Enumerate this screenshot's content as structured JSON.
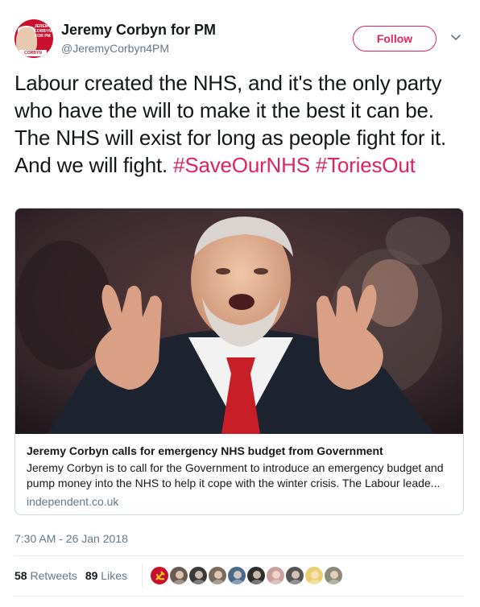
{
  "author": {
    "display_name": "Jeremy Corbyn for PM",
    "handle": "@JeremyCorbyn4PM",
    "avatar_text": "JEREMY CORBYN FOR PM",
    "avatar_strip": "CORBYN"
  },
  "follow_button": "Follow",
  "tweet": {
    "text": "Labour created the NHS, and it's the only party who have the will to make it the best it can be. The NHS will exist for long as people fight for it. And we will fight. ",
    "hashtags": [
      "#SaveOurNHS",
      "#ToriesOut"
    ]
  },
  "card": {
    "title": "Jeremy Corbyn calls for emergency NHS budget from Government",
    "description": "Jeremy Corbyn is to call for the Government to introduce an emergency budget and pump money into the NHS to help it cope with the winter crisis. The Labour leade...",
    "domain": "independent.co.uk"
  },
  "timestamp": "7:30 AM - 26 Jan 2018",
  "stats": {
    "retweets_count": "58",
    "retweets_label": "Retweets",
    "likes_count": "89",
    "likes_label": "Likes"
  },
  "likers": [
    {
      "color": "#c8102e",
      "icon": "hammer-sickle-icon"
    },
    {
      "color": "#6b5a4e",
      "icon": "avatar"
    },
    {
      "color": "#3a3a3a",
      "icon": "avatar"
    },
    {
      "color": "#7a6a5a",
      "icon": "avatar"
    },
    {
      "color": "#4a6a8a",
      "icon": "avatar"
    },
    {
      "color": "#2e2e2e",
      "icon": "avatar"
    },
    {
      "color": "#c9a0a0",
      "icon": "avatar"
    },
    {
      "color": "#555555",
      "icon": "avatar"
    },
    {
      "color": "#e8d070",
      "icon": "avatar"
    },
    {
      "color": "#8a8a7a",
      "icon": "avatar"
    }
  ],
  "colors": {
    "accent": "#e0245e",
    "text": "#14171a",
    "muted": "#657786",
    "border": "#ccd6dd"
  }
}
